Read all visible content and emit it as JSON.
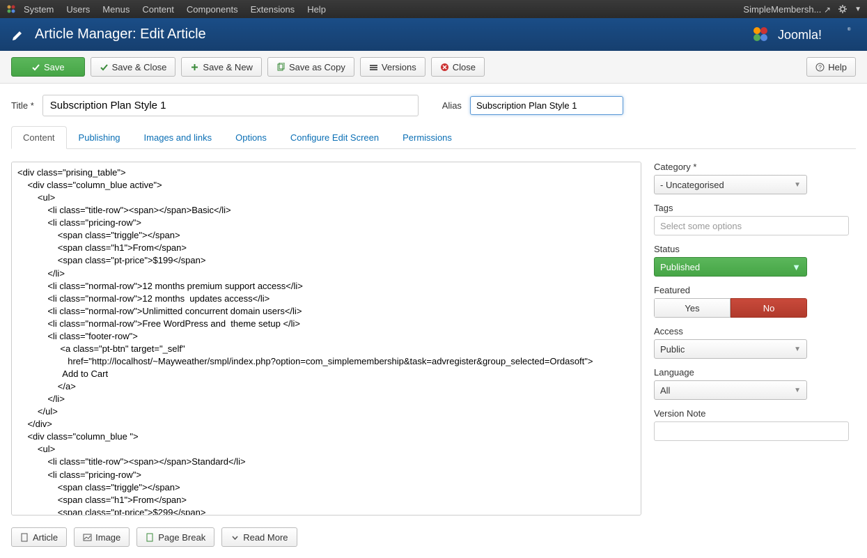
{
  "topmenu": {
    "items": [
      "System",
      "Users",
      "Menus",
      "Content",
      "Components",
      "Extensions",
      "Help"
    ],
    "site_name": "SimpleMembersh..."
  },
  "header": {
    "title": "Article Manager: Edit Article",
    "logo_text": "Joomla!"
  },
  "toolbar": {
    "save": "Save",
    "save_close": "Save & Close",
    "save_new": "Save & New",
    "save_copy": "Save as Copy",
    "versions": "Versions",
    "close": "Close",
    "help": "Help"
  },
  "form": {
    "title_label": "Title *",
    "title_value": "Subscription Plan Style 1",
    "alias_label": "Alias",
    "alias_value": "Subscription Plan Style 1"
  },
  "tabs": [
    "Content",
    "Publishing",
    "Images and links",
    "Options",
    "Configure Edit Screen",
    "Permissions"
  ],
  "editor_content": "<div class=\"prising_table\">\n    <div class=\"column_blue active\">\n        <ul>\n            <li class=\"title-row\"><span></span>Basic</li>\n            <li class=\"pricing-row\">\n                <span class=\"triggle\"></span>\n                <span class=\"h1\">From</span>\n                <span class=\"pt-price\">$199</span>\n            </li>\n            <li class=\"normal-row\">12 months premium support access</li>\n            <li class=\"normal-row\">12 months  updates access</li>\n            <li class=\"normal-row\">Unlimitted concurrent domain users</li>\n            <li class=\"normal-row\">Free WordPress and  theme setup </li>\n            <li class=\"footer-row\">\n                 <a class=\"pt-btn\" target=\"_self\"\n                    href=\"http://localhost/~Mayweather/smpl/index.php?option=com_simplemembership&task=advregister&group_selected=Ordasoft\">\n                  Add to Cart\n                </a>\n            </li>\n        </ul>\n    </div>\n    <div class=\"column_blue \">\n        <ul>\n            <li class=\"title-row\"><span></span>Standard</li>\n            <li class=\"pricing-row\">\n                <span class=\"triggle\"></span>\n                <span class=\"h1\">From</span>\n                <span class=\"pt-price\">$299</span>",
  "sidebar": {
    "category_label": "Category *",
    "category_value": "- Uncategorised",
    "tags_label": "Tags",
    "tags_placeholder": "Select some options",
    "status_label": "Status",
    "status_value": "Published",
    "featured_label": "Featured",
    "featured_yes": "Yes",
    "featured_no": "No",
    "access_label": "Access",
    "access_value": "Public",
    "language_label": "Language",
    "language_value": "All",
    "version_note_label": "Version Note"
  },
  "bottom_buttons": {
    "article": "Article",
    "image": "Image",
    "pagebreak": "Page Break",
    "readmore": "Read More"
  }
}
